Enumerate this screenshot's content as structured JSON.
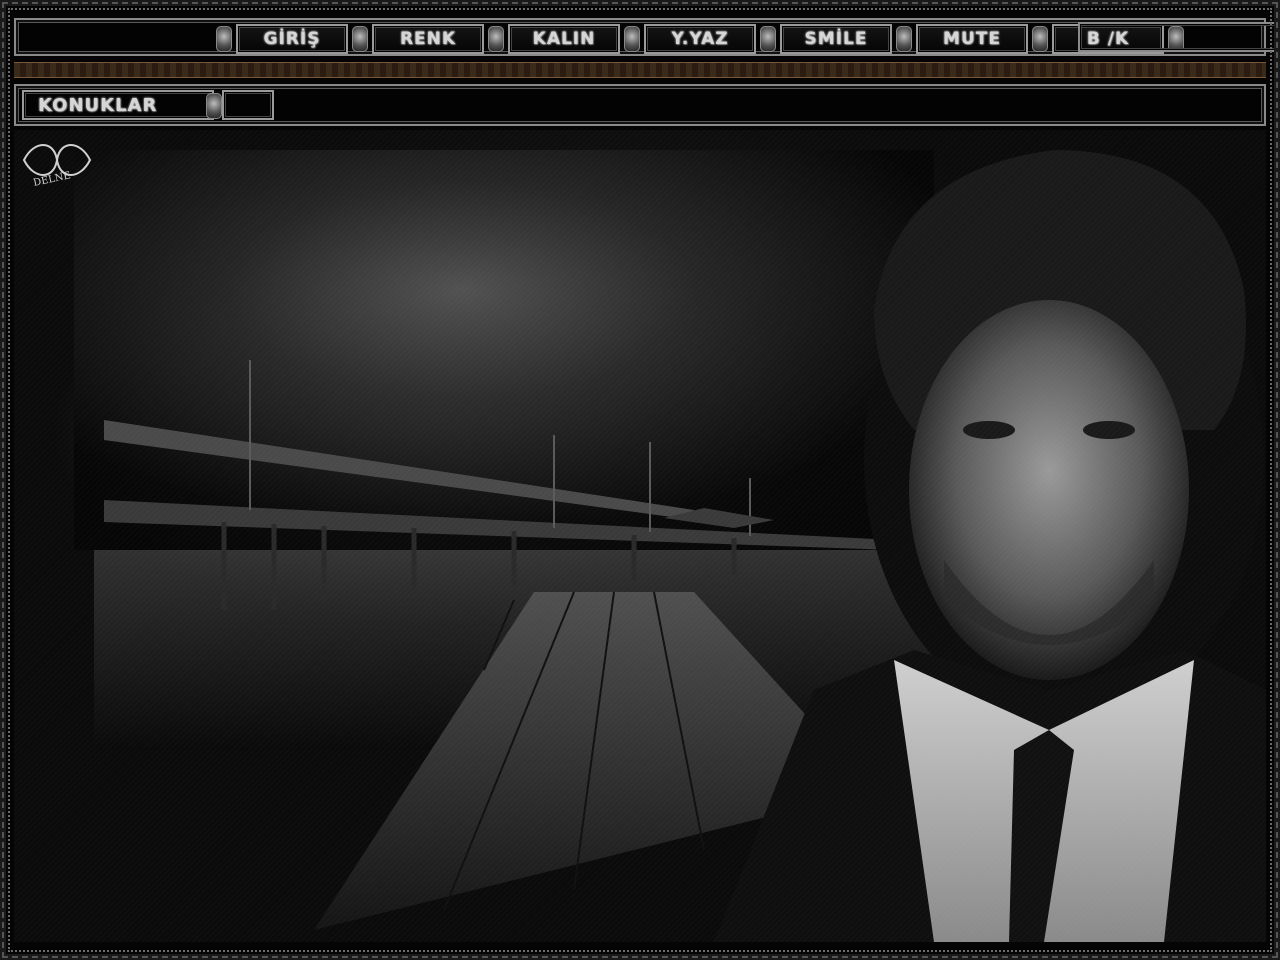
{
  "menu": {
    "items": [
      {
        "label": "GİRİŞ"
      },
      {
        "label": "RENK"
      },
      {
        "label": "KALIN"
      },
      {
        "label": "Y.YAZ"
      },
      {
        "label": "SMİLE"
      },
      {
        "label": "MUTE"
      },
      {
        "label": "B /K"
      }
    ]
  },
  "guests": {
    "label": "KONUKLAR"
  },
  "signature": {
    "text": "DELNE"
  },
  "colors": {
    "background": "#050505",
    "border": "#8a8a8a",
    "text": "#d6d6d6",
    "separator": "#3a2a1a"
  }
}
